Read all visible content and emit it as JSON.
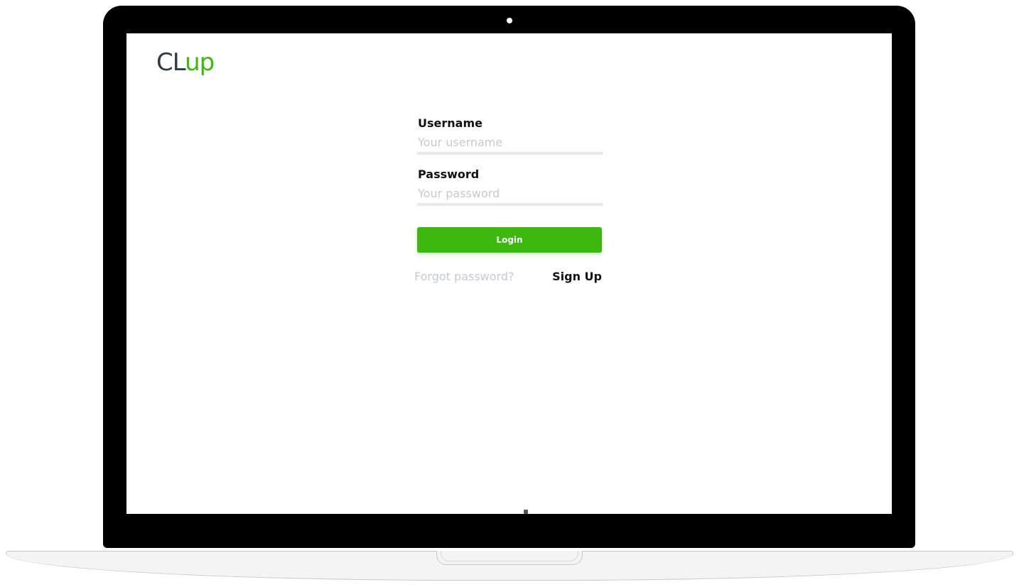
{
  "brand": {
    "logo_part1": "CL",
    "logo_part2": "up",
    "colors": {
      "dark": "#323a42",
      "accent": "#3db80f"
    }
  },
  "login_form": {
    "username_label": "Username",
    "username_placeholder": "Your username",
    "username_value": "",
    "password_label": "Password",
    "password_placeholder": "Your password",
    "password_value": "",
    "login_button_label": "Login",
    "forgot_password_link": "Forgot password?",
    "sign_up_link": "Sign Up"
  }
}
